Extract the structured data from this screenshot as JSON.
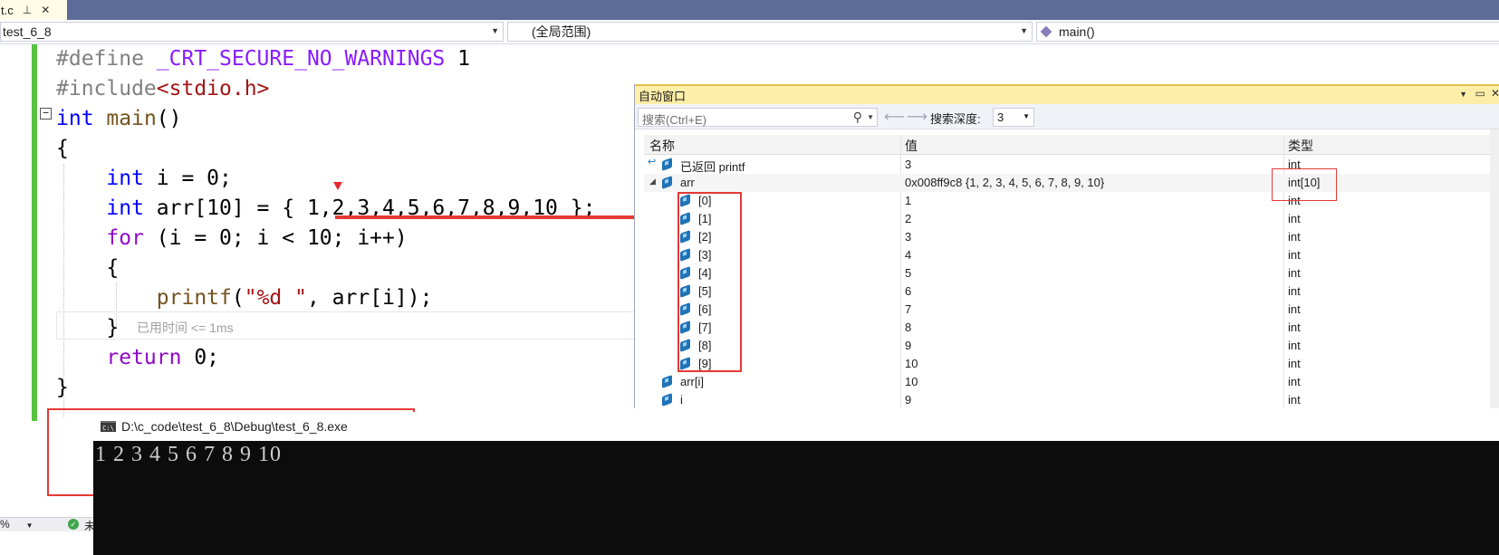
{
  "tab": {
    "title": "t.c",
    "pin_icon": "pin-icon",
    "close_icon": "close-icon"
  },
  "navbar": {
    "project": "test_6_8",
    "scope": "(全局范围)",
    "member": "main()"
  },
  "code": {
    "lines": [
      [
        [
          "pp",
          "#define "
        ],
        [
          "macro",
          "_CRT_SECURE_NO_WARNINGS"
        ],
        [
          "plain",
          " 1"
        ]
      ],
      [
        [
          "pp",
          "#include"
        ],
        [
          "str",
          "<stdio.h>"
        ]
      ],
      [
        [
          "kw",
          "int"
        ],
        [
          "plain",
          " "
        ],
        [
          "fn",
          "main"
        ],
        [
          "plain",
          "()"
        ]
      ],
      [
        [
          "plain",
          "{"
        ]
      ],
      [
        [
          "plain",
          "    "
        ],
        [
          "kw",
          "int"
        ],
        [
          "plain",
          " i = 0;"
        ]
      ],
      [
        [
          "plain",
          "    "
        ],
        [
          "kw",
          "int"
        ],
        [
          "plain",
          " arr[10] = { 1,2,3,4,5,6,7,8,9,10 };"
        ]
      ],
      [
        [
          "plain",
          "    "
        ],
        [
          "ctl",
          "for"
        ],
        [
          "plain",
          " (i = 0; i < 10; i++)"
        ]
      ],
      [
        [
          "plain",
          "    {"
        ]
      ],
      [
        [
          "plain",
          "        "
        ],
        [
          "fn",
          "printf"
        ],
        [
          "plain",
          "("
        ],
        [
          "str",
          "\"%d \""
        ],
        [
          "plain",
          ", arr[i]);"
        ]
      ],
      [
        [
          "plain",
          "    }"
        ]
      ],
      [
        [
          "plain",
          "    "
        ],
        [
          "ctl",
          "return"
        ],
        [
          "plain",
          " 0;"
        ]
      ],
      [
        [
          "plain",
          "}"
        ]
      ]
    ],
    "elapsed": "已用时间 <= 1ms",
    "fold_glyph": "−"
  },
  "autos": {
    "title": "自动窗口",
    "search_placeholder": "搜索(Ctrl+E)",
    "search_icon": "search-icon",
    "depth_label": "搜索深度:",
    "depth_value": "3",
    "columns": {
      "name": "名称",
      "value": "值",
      "type": "类型"
    },
    "rows": [
      {
        "name": "已返回 printf",
        "value": "3",
        "type": "int",
        "level": 0,
        "icon": "return-value-icon"
      },
      {
        "name": "arr",
        "value": "0x008ff9c8 {1, 2, 3, 4, 5, 6, 7, 8, 9, 10}",
        "type": "int[10]",
        "level": 0,
        "expanded": true,
        "icon": "variable-icon"
      },
      {
        "name": "[0]",
        "value": "1",
        "type": "int",
        "level": 1,
        "icon": "variable-icon"
      },
      {
        "name": "[1]",
        "value": "2",
        "type": "int",
        "level": 1,
        "icon": "variable-icon"
      },
      {
        "name": "[2]",
        "value": "3",
        "type": "int",
        "level": 1,
        "icon": "variable-icon"
      },
      {
        "name": "[3]",
        "value": "4",
        "type": "int",
        "level": 1,
        "icon": "variable-icon"
      },
      {
        "name": "[4]",
        "value": "5",
        "type": "int",
        "level": 1,
        "icon": "variable-icon"
      },
      {
        "name": "[5]",
        "value": "6",
        "type": "int",
        "level": 1,
        "icon": "variable-icon"
      },
      {
        "name": "[6]",
        "value": "7",
        "type": "int",
        "level": 1,
        "icon": "variable-icon"
      },
      {
        "name": "[7]",
        "value": "8",
        "type": "int",
        "level": 1,
        "icon": "variable-icon"
      },
      {
        "name": "[8]",
        "value": "9",
        "type": "int",
        "level": 1,
        "icon": "variable-icon"
      },
      {
        "name": "[9]",
        "value": "10",
        "type": "int",
        "level": 1,
        "icon": "variable-icon"
      },
      {
        "name": "arr[i]",
        "value": "10",
        "type": "int",
        "level": 0,
        "icon": "variable-icon"
      },
      {
        "name": "i",
        "value": "9",
        "type": "int",
        "level": 0,
        "icon": "variable-icon"
      }
    ]
  },
  "console": {
    "path": "D:\\c_code\\test_6_8\\Debug\\test_6_8.exe",
    "output": "1 2 3 4 5 6 7 8 9 10",
    "icon_text": "C:\\"
  },
  "status": {
    "zoom": "%",
    "trailing": "未"
  },
  "colors": {
    "keyword": "#0000ff",
    "macro": "#8a1bff",
    "string": "#a31515",
    "control": "#8f08c4",
    "highlight": "#e53935",
    "change_bar": "#57c440",
    "autos_title": "#ffeea8"
  }
}
